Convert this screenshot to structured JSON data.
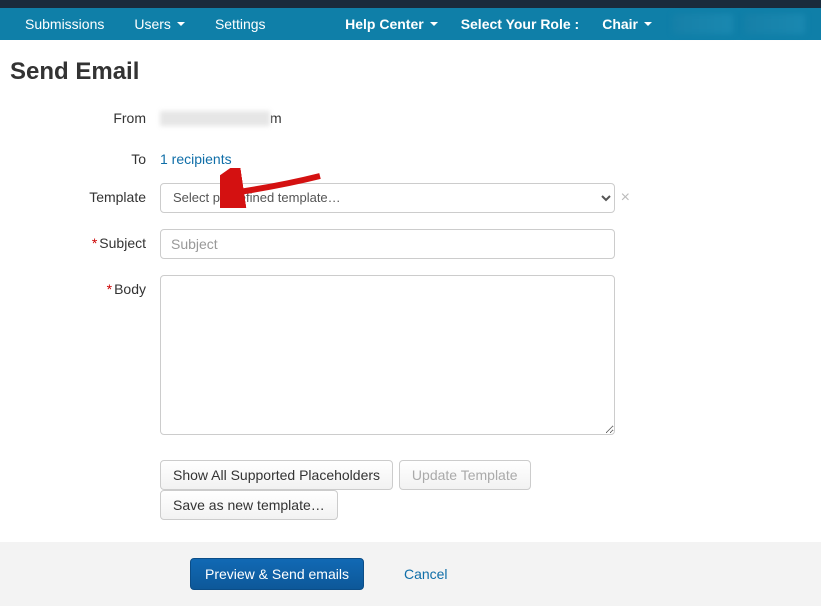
{
  "nav": {
    "submissions": "Submissions",
    "users": "Users",
    "settings": "Settings",
    "help_center": "Help Center",
    "select_role_label": "Select Your Role :",
    "chair": "Chair"
  },
  "page": {
    "title": "Send Email"
  },
  "form": {
    "from_label": "From",
    "from_suffix": "m",
    "to_label": "To",
    "to_value": "1 recipients",
    "template_label": "Template",
    "template_placeholder": "Select predefined template…",
    "subject_label": "Subject",
    "subject_placeholder": "Subject",
    "body_label": "Body"
  },
  "buttons": {
    "show_placeholders": "Show All Supported Placeholders",
    "update_template": "Update Template",
    "save_template": "Save as new template…",
    "preview_send": "Preview & Send emails",
    "cancel": "Cancel"
  }
}
